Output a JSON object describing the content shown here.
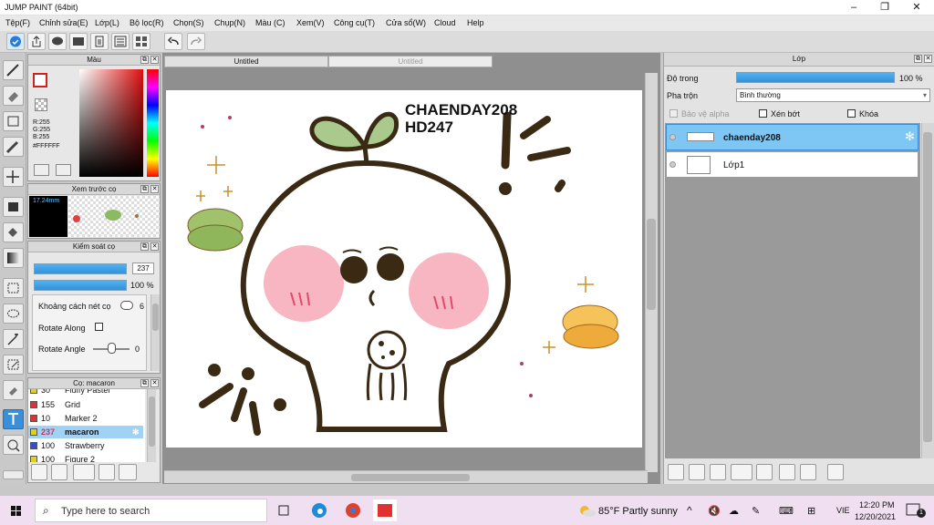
{
  "window": {
    "title": "JUMP PAINT (64bit)",
    "controls": [
      "–",
      "❐",
      "✕"
    ]
  },
  "menu": [
    "Tệp(F)",
    "Chỉnh sửa(E)",
    "Lớp(L)",
    "Bộ lọc(R)",
    "Chọn(S)",
    "Chụp(N)",
    "Màu (C)",
    "Xem(V)",
    "Công cụ(T)",
    "Cửa sổ(W)",
    "Cloud",
    "Help"
  ],
  "panels": {
    "color": {
      "title": "Màu",
      "r": "R:255",
      "g": "G:255",
      "b": "B:255",
      "hex": "#FFFFFF"
    },
    "brush_preview": {
      "title": "Xem trước cọ",
      "size": "17.24mm"
    },
    "brush_control": {
      "title": "Kiểm soát cọ",
      "size_value": "237",
      "opacity_value": "100 %",
      "spacing_label": "Khoảng cách nét cọ",
      "spacing_value": "6",
      "rotate_along_label": "Rotate Along",
      "rotate_angle_label": "Rotate Angle",
      "rotate_angle_value": "0"
    },
    "brush_list": {
      "title": "Cọ: macaron",
      "items": [
        {
          "num": "30",
          "name": "Fluffy Pastel",
          "color": "#e0d020"
        },
        {
          "num": "155",
          "name": "Grid",
          "color": "#e03030"
        },
        {
          "num": "10",
          "name": "Marker 2",
          "color": "#e03030"
        },
        {
          "num": "237",
          "name": "macaron",
          "color": "#e0d020",
          "selected": true
        },
        {
          "num": "100",
          "name": "Strawberry",
          "color": "#3050d0"
        },
        {
          "num": "100",
          "name": "Figure 2",
          "color": "#e0d020"
        }
      ]
    }
  },
  "canvas": {
    "tabs": [
      "Untitled",
      "Untitled"
    ],
    "text_line1": "CHAENDAY208",
    "text_line2": "HD247"
  },
  "layers": {
    "title": "Lớp",
    "opacity_label": "Độ trong",
    "opacity_value": "100 %",
    "blend_label": "Pha trộn",
    "blend_value": "Bình thường",
    "protect_alpha": "Bảo vệ alpha",
    "clip": "Xén bớt",
    "lock": "Khóa",
    "items": [
      {
        "name": "chaenday208",
        "selected": true
      },
      {
        "name": "Lớp1",
        "selected": false
      }
    ]
  },
  "taskbar": {
    "search_placeholder": "Type here to search",
    "weather": "85°F  Partly sunny",
    "lang": "VIE",
    "time": "12:20 PM",
    "date": "12/20/2021",
    "notif": "1"
  }
}
